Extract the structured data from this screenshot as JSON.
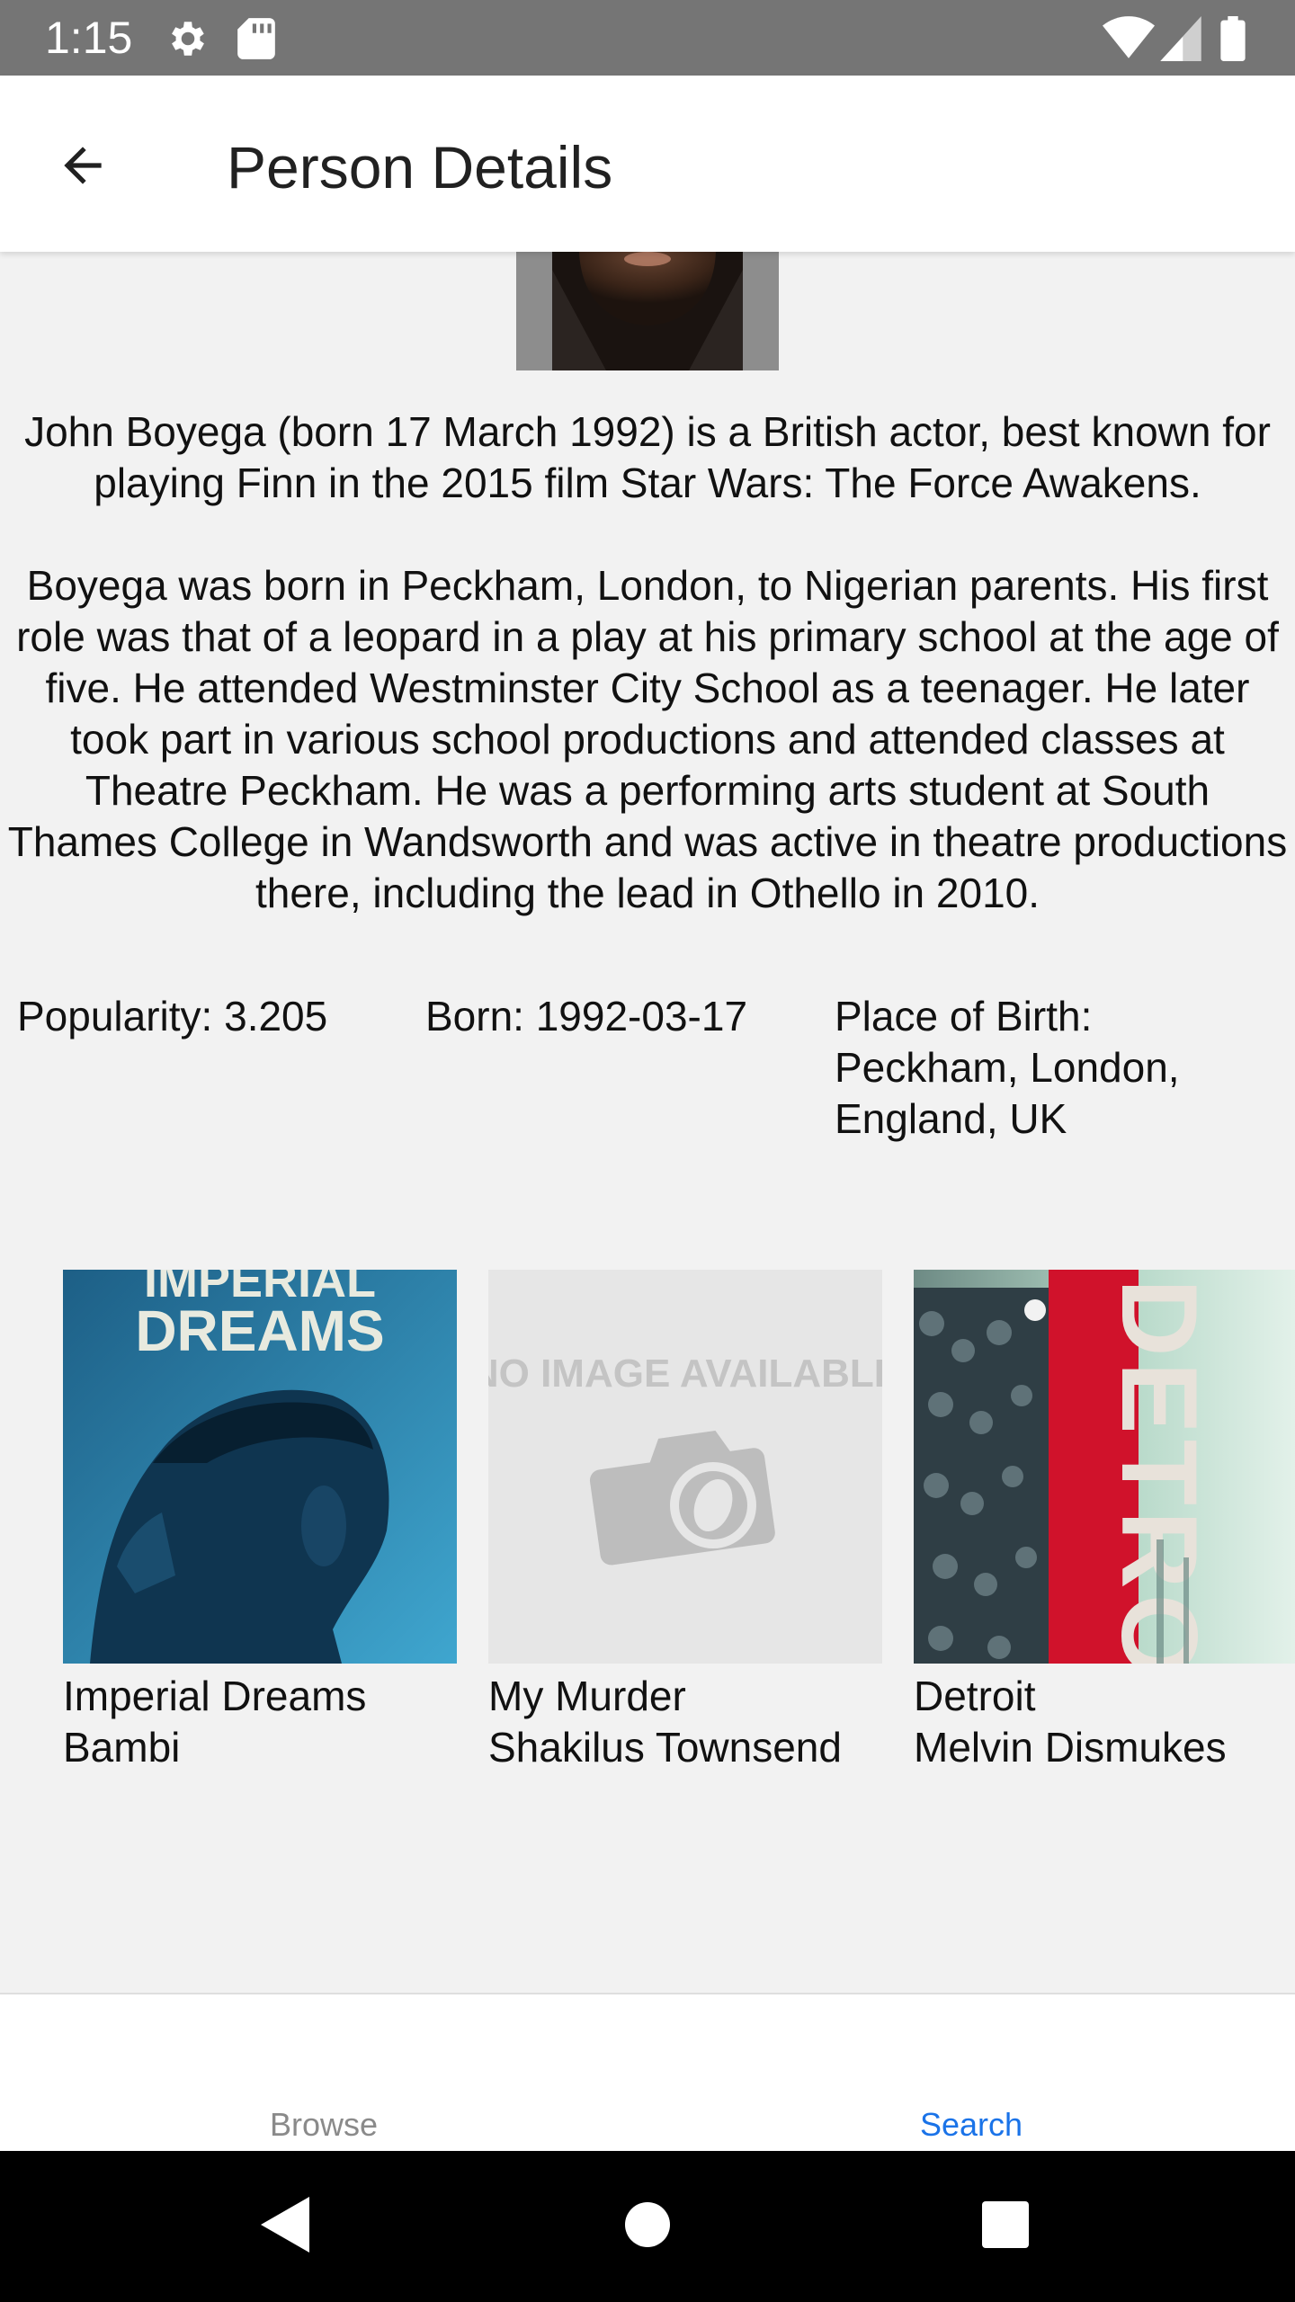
{
  "status_bar": {
    "time": "1:15",
    "background": "#757575",
    "left_icons": [
      "gear-icon",
      "sd-card-icon"
    ],
    "right_icons": [
      "wifi-icon",
      "signal-icon",
      "battery-icon"
    ]
  },
  "app_bar": {
    "back_icon": "arrow-back-icon",
    "title": "Person Details"
  },
  "person": {
    "bio_paragraphs": [
      "John Boyega (born 17 March 1992) is a British actor, best known for playing Finn in the 2015 film Star Wars: The Force Awakens.",
      "Boyega was born in Peckham, London, to Nigerian parents. His first role was that of a leopard in a play at his primary school at the age of five. He attended Westminster City School as a teenager. He later took part in various school productions and attended classes at Theatre Peckham. He was a performing arts student at South Thames College in Wandsworth and was active in theatre productions there, including the lead in Othello in 2010."
    ],
    "popularity": "Popularity: 3.205",
    "born": "Born: 1992-03-17",
    "place_of_birth": "Place of Birth: Peckham, London, England, UK"
  },
  "credits": [
    {
      "title": "Imperial Dreams",
      "role": "Bambi",
      "poster_text": "IMPERIAL DREAMS"
    },
    {
      "title": "My Murder",
      "role": "Shakilus Townsend",
      "poster_text": "NO IMAGE AVAILABLE"
    },
    {
      "title": "Detroit",
      "role": "Melvin Dismukes",
      "poster_text": "DETROIT"
    }
  ],
  "bottom_nav": {
    "tabs": [
      {
        "label": "Browse",
        "active": false
      },
      {
        "label": "Search",
        "active": true
      }
    ],
    "active_color": "#1a73e8",
    "inactive_color": "#8a8a8a"
  },
  "system_nav": {
    "buttons": [
      "back-triangle-icon",
      "home-circle-icon",
      "recents-square-icon"
    ]
  }
}
